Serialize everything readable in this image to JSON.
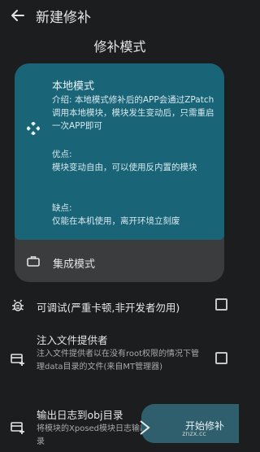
{
  "header": {
    "title": "新建修补",
    "back_icon": "arrow-left-icon"
  },
  "section_title": "修补模式",
  "modes": {
    "selected": {
      "icon": "diamond-dots-icon",
      "title": "本地模式",
      "intro": "介绍: 本地模式修补后的APP会通过ZPatch调用本地模块，模块发生变动后，只需重启一次APP即可",
      "pros_label": "优点:",
      "pros": "模块变动自由，可以使用反内置的模块",
      "cons_label": "缺点:",
      "cons": "仅能在本机使用，离开环境立刻废"
    },
    "integrated": {
      "icon": "briefcase-icon",
      "label": "集成模式"
    }
  },
  "options": [
    {
      "icon": "bug-icon",
      "title": "可调试(严重卡顿,非开发者勿用)",
      "desc": "",
      "checked": false
    },
    {
      "icon": "file-add-icon",
      "title": "注入文件提供者",
      "desc": "注入文件提供者以在没有root权限的情况下管理data目录的文件(来自MT管理器)",
      "checked": false
    },
    {
      "icon": "file-add-icon",
      "title": "输出日志到obj目录",
      "desc": "将模块的Xposed模块日志输出到App的obj目录",
      "checked": false
    }
  ],
  "fab": {
    "label": "开始修补"
  },
  "colors": {
    "background": "#1b1d1e",
    "selected_card": "#1a6478",
    "card": "#3a3c3d",
    "fab": "#2f5f6d"
  },
  "watermark": {
    "text": "znzx.cc"
  }
}
